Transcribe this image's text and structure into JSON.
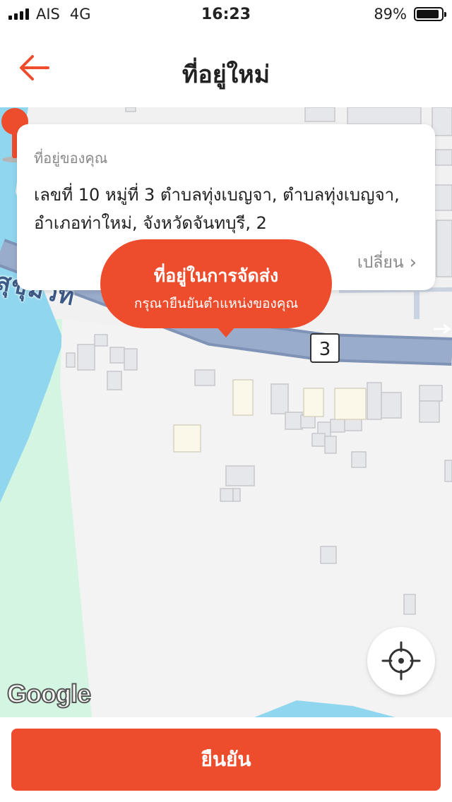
{
  "status_bar": {
    "carrier": "AIS",
    "network": "4G",
    "time": "16:23",
    "battery": "89%"
  },
  "header": {
    "title": "ที่อยู่ใหม่",
    "back_icon": "arrow-left-icon"
  },
  "address_card": {
    "label": "ที่อยู่ของคุณ",
    "address": "เลขที่ 10 หมู่ที่ 3 ตำบลทุ่งเบญจา, ตำบลทุ่งเบญจา, อำเภอท่าใหม่, จังหวัดจันทบุรี, 2",
    "change_label": "เปลี่ยน"
  },
  "tooltip": {
    "title": "ที่อยู่ในการจัดส่ง",
    "subtitle": "กรุณายืนยันตำแหน่งของคุณ"
  },
  "map": {
    "road_label": "สุขุมวิท",
    "route_shield": "3",
    "attribution": "Google",
    "locate_icon": "crosshair-icon",
    "pin_icon": "map-pin-icon"
  },
  "confirm_button": {
    "label": "ยืนยัน"
  },
  "colors": {
    "accent": "#ee4d2d",
    "water": "#8fd6ee",
    "park": "#d3f5e2",
    "road": "#8fa3c2"
  }
}
